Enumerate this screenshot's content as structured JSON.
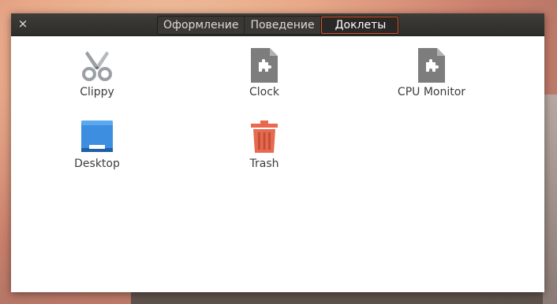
{
  "window": {
    "close_symbol": "×",
    "tabs": [
      {
        "label": "Оформление",
        "active": false
      },
      {
        "label": "Поведение",
        "active": false
      },
      {
        "label": "Доклеты",
        "active": true
      }
    ]
  },
  "docklets": [
    {
      "label": "Clippy",
      "icon": "scissors-icon"
    },
    {
      "label": "Clock",
      "icon": "plugin-document-icon"
    },
    {
      "label": "CPU Monitor",
      "icon": "plugin-document-icon"
    },
    {
      "label": "Desktop",
      "icon": "desktop-icon"
    },
    {
      "label": "Trash",
      "icon": "trash-icon"
    }
  ],
  "colors": {
    "titlebar": "#2f2d2a",
    "active_tab_border": "#d8552a",
    "trash": "#e8694f",
    "desktop_blue": "#3d8ee0",
    "plugin_gray": "#7a7a7a"
  }
}
